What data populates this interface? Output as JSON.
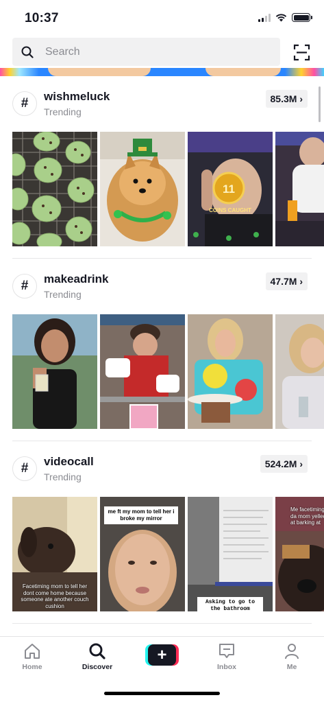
{
  "status": {
    "time": "10:37"
  },
  "search": {
    "placeholder": "Search"
  },
  "sections": [
    {
      "hashtag": "wishmeluck",
      "subtitle": "Trending",
      "count": "85.3M",
      "thumbnails": [
        {
          "subject": "green cookies on cooling rack"
        },
        {
          "subject": "pomeranian in green leprechaun hat"
        },
        {
          "subject": "man with coin effect",
          "overlay_number": "11",
          "overlay_text": "COINS CAUGHT"
        },
        {
          "subject": "man pouring drink"
        }
      ]
    },
    {
      "hashtag": "makeadrink",
      "subtitle": "Trending",
      "count": "47.7M",
      "thumbnails": [
        {
          "subject": "woman holding a drink outdoors"
        },
        {
          "subject": "person pouring drinks at counter"
        },
        {
          "subject": "girl in tie-dye shirt with strainer"
        },
        {
          "subject": "girl in kitchen"
        }
      ]
    },
    {
      "hashtag": "videocall",
      "subtitle": "Trending",
      "count": "524.2M",
      "thumbnails": [
        {
          "subject": "dog lying down",
          "caption": "Facetiming mom to tell her dont come home because someone ate another couch cushion"
        },
        {
          "subject": "girl face close up",
          "caption": "me ft my mom to tell her i broke my mirror"
        },
        {
          "subject": "laptop screen",
          "caption": "Asking to go to the bathroom during an"
        },
        {
          "subject": "dog face",
          "caption": "Me facetiming da mom yelled at barking at"
        }
      ]
    }
  ],
  "nav": {
    "home": "Home",
    "discover": "Discover",
    "create": "+",
    "inbox": "Inbox",
    "me": "Me"
  },
  "colors": {
    "accent_cyan": "#25f4ee",
    "accent_red": "#fe2c55",
    "text_primary": "#161823",
    "text_secondary": "#8a8b91"
  }
}
